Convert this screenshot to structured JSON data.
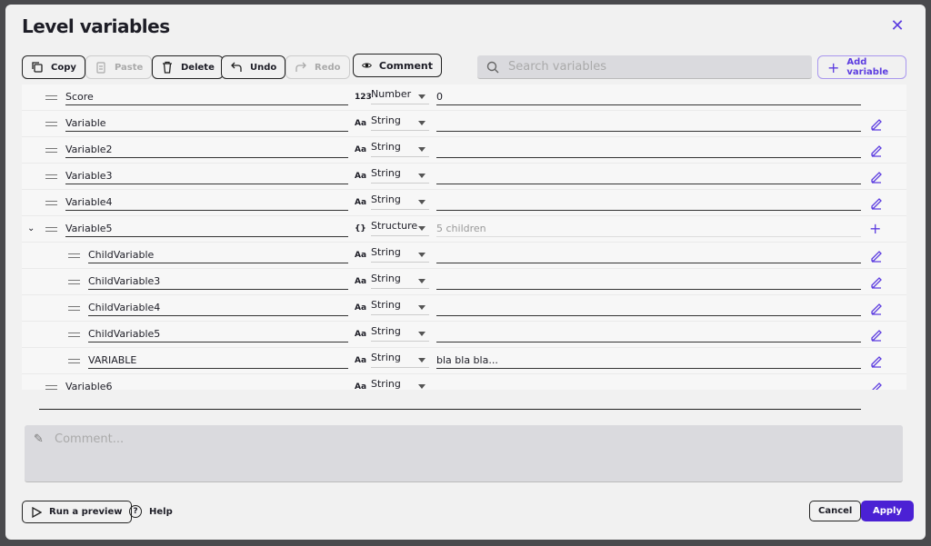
{
  "dialog": {
    "title": "Level variables"
  },
  "toolbar": {
    "copy": "Copy",
    "paste": "Paste",
    "delete": "Delete",
    "undo": "Undo",
    "redo": "Redo",
    "comment": "Comment",
    "search_placeholder": "Search variables",
    "add_variable": "Add variable"
  },
  "rows": [
    {
      "name": "Score",
      "type": "Number",
      "type_icon": "123",
      "value": "0",
      "child": false
    },
    {
      "name": "Variable",
      "type": "String",
      "type_icon": "Aa",
      "value": "",
      "child": false
    },
    {
      "name": "Variable2",
      "type": "String",
      "type_icon": "Aa",
      "value": "",
      "child": false
    },
    {
      "name": "Variable3",
      "type": "String",
      "type_icon": "Aa",
      "value": "",
      "child": false
    },
    {
      "name": "Variable4",
      "type": "String",
      "type_icon": "Aa",
      "value": "",
      "child": false
    },
    {
      "name": "Variable5",
      "type": "Structure",
      "type_icon": "{}",
      "value": "5 children",
      "child": false,
      "expanded": true
    },
    {
      "name": "ChildVariable",
      "type": "String",
      "type_icon": "Aa",
      "value": "",
      "child": true
    },
    {
      "name": "ChildVariable3",
      "type": "String",
      "type_icon": "Aa",
      "value": "",
      "child": true
    },
    {
      "name": "ChildVariable4",
      "type": "String",
      "type_icon": "Aa",
      "value": "",
      "child": true
    },
    {
      "name": "ChildVariable5",
      "type": "String",
      "type_icon": "Aa",
      "value": "",
      "child": true
    },
    {
      "name": "VARIABLE",
      "type": "String",
      "type_icon": "Aa",
      "value": "bla bla bla...",
      "child": true
    },
    {
      "name": "Variable6",
      "type": "String",
      "type_icon": "Aa",
      "value": "",
      "child": false
    }
  ],
  "comment": {
    "placeholder": "Comment..."
  },
  "footer": {
    "preview": "Run a preview",
    "help": "Help",
    "cancel": "Cancel",
    "apply": "Apply"
  },
  "colors": {
    "accent": "#4b21d4"
  }
}
